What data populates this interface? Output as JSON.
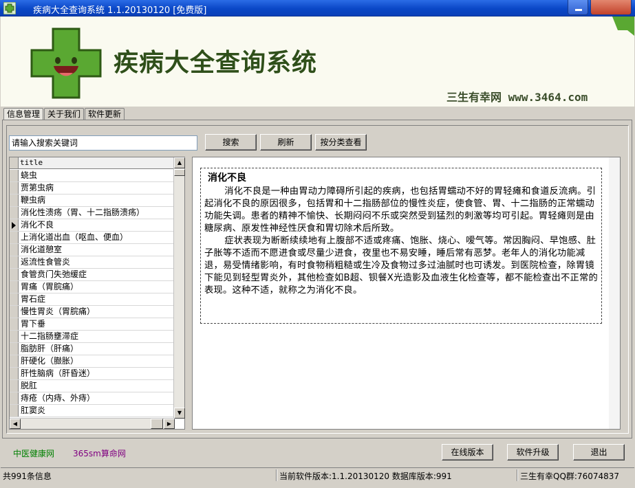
{
  "window": {
    "title": "疾病大全查询系统 1.1.20130120 [免费版]"
  },
  "header": {
    "app_title": "疾病大全查询系统",
    "site_label": "三生有幸网 www.3464.com"
  },
  "tabs": [
    "信息管理",
    "关于我们",
    "软件更新"
  ],
  "search": {
    "value": "请输入搜索关键词"
  },
  "buttons": {
    "search": "搜索",
    "refresh": "刷新",
    "by_category": "按分类查看",
    "online": "在线版本",
    "upgrade": "软件升级",
    "exit": "退出"
  },
  "list": {
    "column": "title",
    "selected_index": 4,
    "items": [
      "蛲虫",
      "贾第虫病",
      "鞭虫病",
      "消化性溃疡（胃、十二指肠溃疡）",
      "消化不良",
      "上消化道出血（呕血、便血）",
      "消化道憩室",
      "返流性食管炎",
      "食管贲门失弛缓症",
      "胃痛（胃脘痛）",
      "胃石症",
      "慢性胃炎（胃脘痛）",
      "胃下垂",
      "十二指肠壅滞症",
      "脂肪肝（肝痛）",
      "肝硬化（臌胀）",
      "肝性脑病（肝昏迷）",
      "脱肛",
      "痔疮（内痔、外痔）",
      "肛窦炎"
    ]
  },
  "content": {
    "title": "消化不良",
    "paragraphs": [
      "消化不良是一种由胃动力障碍所引起的疾病，也包括胃蠕动不好的胃轻瘫和食道反流病。引起消化不良的原因很多，包括胃和十二指肠部位的慢性炎症，使食管、胃、十二指肠的正常蠕动功能失调。患者的精神不愉快、长期闷闷不乐或突然受到猛烈的刺激等均可引起。胃轻瘫则是由糖尿病、原发性神经性厌食和胃切除术后所致。",
      "症状表现为断断续续地有上腹部不适或疼痛、饱胀、烧心、嗳气等。常因胸闷、早饱感、肚子胀等不适而不愿进食或尽量少进食，夜里也不易安睡，睡后常有恶梦。老年人的消化功能减退，易受情绪影响，有时食物稍粗糙或生冷及食物过多过油腻时也可诱发。到医院检查，除胃镜下能见到轻型胃炎外，其他检查如B超、钡餐X光造影及血液生化检查等，都不能检查出不正常的表现。这种不适，就称之为消化不良。"
    ]
  },
  "links": {
    "tcm": "中医健康网",
    "fortune": "365sm算命网"
  },
  "status": {
    "count": "共991条信息",
    "version": "当前软件版本:1.1.20130120 数据库版本:991",
    "qq": "三生有幸QQ群:76074837"
  },
  "colors": {
    "titlebar": "#0a47c6",
    "logo_green": "#5aa832",
    "link_green": "#008000",
    "link_purple": "#800080"
  }
}
